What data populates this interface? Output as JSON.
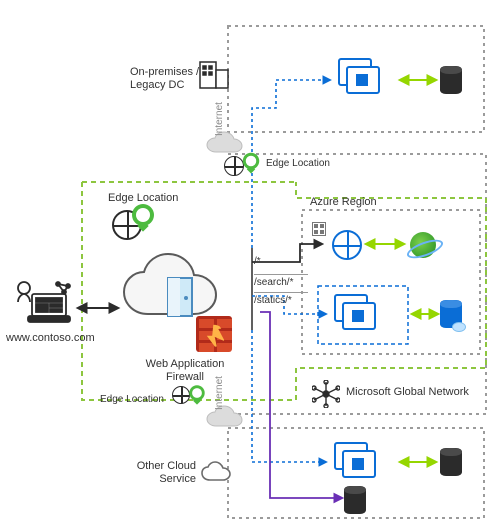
{
  "site_url": "www.contoso.com",
  "labels": {
    "on_prem": "On-premises /\nLegacy DC",
    "edge_top": "Edge Location",
    "edge_left": "Edge Location",
    "edge_bottom": "Edge Location",
    "azure_region": "Azure Region",
    "waf": "Web Application\nFirewall",
    "mgn": "Microsoft Global Network",
    "other_cloud": "Other Cloud\nService",
    "internet_top": "Internet",
    "internet_bottom": "Internet"
  },
  "routes": {
    "root": "/*",
    "search": "/search/*",
    "statics": "/statics/*"
  },
  "icons": {
    "client": "client-laptop",
    "building": "office-building",
    "cloud_door": "cloud-with-door",
    "firewall": "firewall-brick",
    "pin": "geo-pin",
    "globe": "globe",
    "servers": "vm-stack",
    "db": "database-cyl",
    "cosmos": "cosmos-planet",
    "network": "global-network-star",
    "internet": "internet-cloud",
    "plain_cloud": "cloud-outline"
  },
  "colors": {
    "azure_blue": "#0a6dd6",
    "green_dash": "#8dc63f",
    "grey_dash": "#9b9b9b",
    "arrow_green": "#95d600",
    "arrow_purple": "#6a2fb5",
    "arrow_black": "#2b2b2b"
  }
}
